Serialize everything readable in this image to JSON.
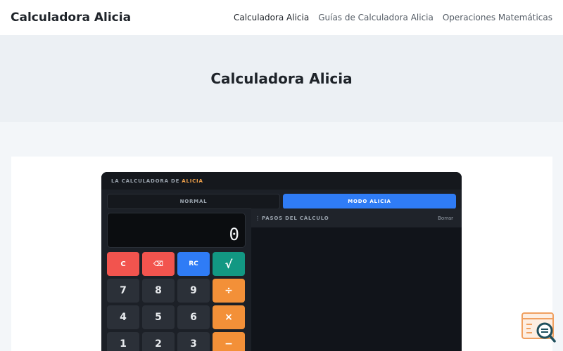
{
  "header": {
    "site_title": "Calculadora Alicia",
    "nav": [
      {
        "label": "Calculadora Alicia"
      },
      {
        "label": "Guías de Calculadora Alicia"
      },
      {
        "label": "Operaciones Matemáticas"
      }
    ]
  },
  "hero": {
    "title": "Calculadora Alicia"
  },
  "calculator": {
    "topbar_prefix": "LA CALCULADORA DE",
    "topbar_brand": "ALICIA",
    "modes": [
      {
        "label": "NORMAL",
        "active": false
      },
      {
        "label": "MODO ALICIA",
        "active": true
      }
    ],
    "display_value": "0",
    "keys": [
      {
        "label": "C",
        "style": "red"
      },
      {
        "label": "⌫",
        "style": "red"
      },
      {
        "label": "RC",
        "style": "blue"
      },
      {
        "label": "√",
        "style": "teal"
      },
      {
        "label": "7",
        "style": "dark"
      },
      {
        "label": "8",
        "style": "dark"
      },
      {
        "label": "9",
        "style": "dark"
      },
      {
        "label": "÷",
        "style": "orange"
      },
      {
        "label": "4",
        "style": "dark"
      },
      {
        "label": "5",
        "style": "dark"
      },
      {
        "label": "6",
        "style": "dark"
      },
      {
        "label": "×",
        "style": "orange"
      },
      {
        "label": "1",
        "style": "dark"
      },
      {
        "label": "2",
        "style": "dark"
      },
      {
        "label": "3",
        "style": "dark"
      },
      {
        "label": "−",
        "style": "orange"
      }
    ],
    "steps_title": "PASOS DEL CÁLCULO",
    "steps_clear": "Borrar"
  },
  "colors": {
    "accent_blue": "#2f7cf6",
    "clear_red": "#f2544e",
    "operator_orange": "#f39038",
    "sqrt_teal": "#129883",
    "brand_orange": "#f0a14a"
  }
}
